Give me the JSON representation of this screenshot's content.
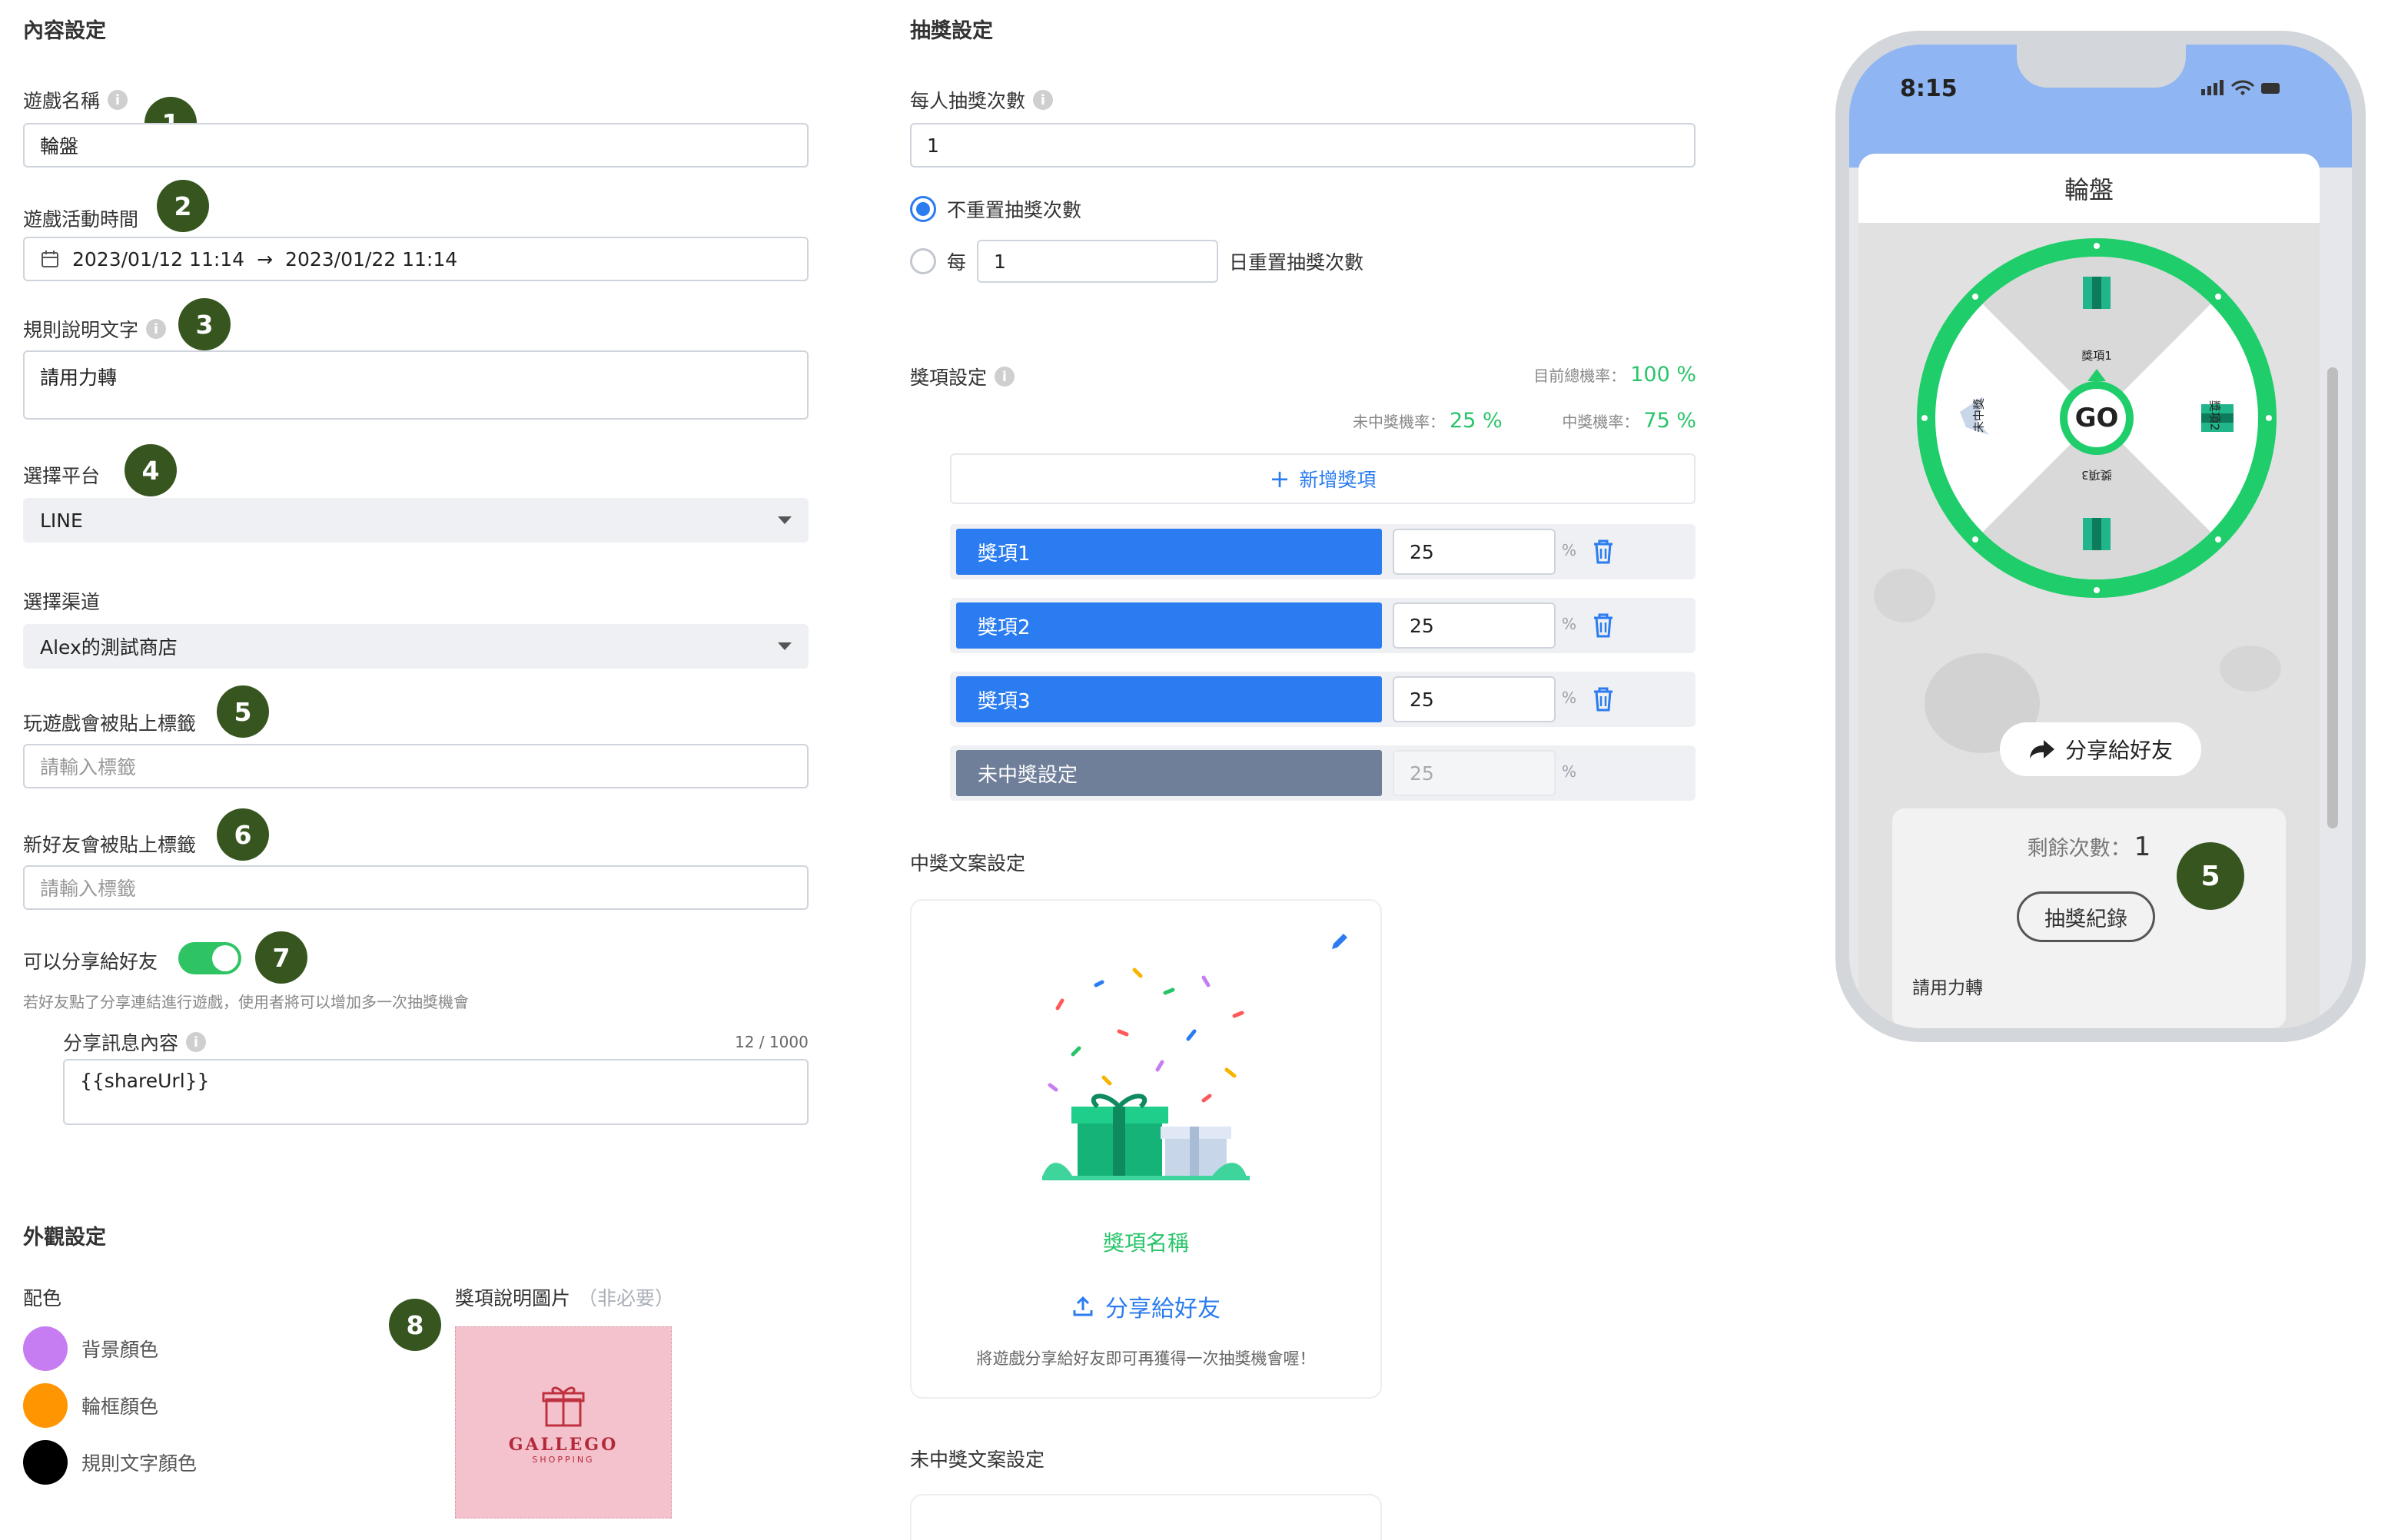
{
  "content": {
    "title": "內容設定",
    "game_name_label": "遊戲名稱",
    "game_name_value": "輪盤",
    "game_time_label": "遊戲活動時間",
    "game_time_start": "2023/01/12 11:14",
    "game_time_arrow": "→",
    "game_time_end": "2023/01/22 11:14",
    "rules_label": "規則說明文字",
    "rules_value": "請用力轉",
    "platform_label": "選擇平台",
    "platform_value": "LINE",
    "channel_label": "選擇渠道",
    "channel_value": "Alex的測試商店",
    "play_tag_label": "玩遊戲會被貼上標籤",
    "play_tag_placeholder": "請輸入標籤",
    "friend_tag_label": "新好友會被貼上標籤",
    "friend_tag_placeholder": "請輸入標籤",
    "share_label": "可以分享給好友",
    "share_hint": "若好友點了分享連結進行遊戲，使用者將可以增加多一次抽獎機會",
    "share_msg_label": "分享訊息內容",
    "share_msg_count": "12 / 1000",
    "share_msg_value": "{{shareUrl}}"
  },
  "appearance": {
    "title": "外觀設定",
    "color_label": "配色",
    "colors": [
      {
        "label": "背景顏色",
        "hex": "#c77df2"
      },
      {
        "label": "輪框顏色",
        "hex": "#ff9500"
      },
      {
        "label": "規則文字顏色",
        "hex": "#000000"
      }
    ],
    "prize_img_label": "獎項說明圖片",
    "prize_img_optional": "（非必要）",
    "logo_text": "GALLEGO",
    "logo_sub": "SHOPPING"
  },
  "draw": {
    "title": "抽獎設定",
    "per_person_label": "每人抽獎次數",
    "per_person_value": "1",
    "no_reset_label": "不重置抽獎次數",
    "every_label": "每",
    "every_value": "1",
    "day_reset_label": "日重置抽獎次數",
    "prize_settings_label": "獎項設定",
    "total_prob_label": "目前總機率：",
    "total_prob_value": "100 %",
    "miss_prob_label": "未中獎機率：",
    "miss_prob_value": "25 %",
    "win_prob_label": "中獎機率：",
    "win_prob_value": "75 %",
    "add_prize_label": "新增獎項",
    "prizes": [
      {
        "name": "獎項1",
        "pct": "25"
      },
      {
        "name": "獎項2",
        "pct": "25"
      },
      {
        "name": "獎項3",
        "pct": "25"
      }
    ],
    "miss_row": {
      "name": "未中獎設定",
      "pct": "25"
    },
    "pct_sign": "%",
    "win_copy_title": "中獎文案設定",
    "win_card_prize_name": "獎項名稱",
    "win_card_share": "分享給好友",
    "win_card_hint": "將遊戲分享給好友即可再獲得一次抽獎機會喔！",
    "miss_copy_title": "未中獎文案設定"
  },
  "phone": {
    "time": "8:15",
    "title": "輪盤",
    "go": "GO",
    "segments": [
      "獎項1",
      "獎項2",
      "獎項3",
      "未中獎"
    ],
    "share_button": "分享給好友",
    "remaining_label": "剩餘次數：",
    "remaining_value": "1",
    "record_button": "抽獎紀錄",
    "rules_text": "請用力轉"
  },
  "badges": [
    "1",
    "2",
    "3",
    "4",
    "5",
    "6",
    "7",
    "8",
    "5"
  ],
  "colors": {
    "accent": "#2b7cf0",
    "green": "#29c46a",
    "badge": "#37561f",
    "wheel": "#1fce6a"
  }
}
